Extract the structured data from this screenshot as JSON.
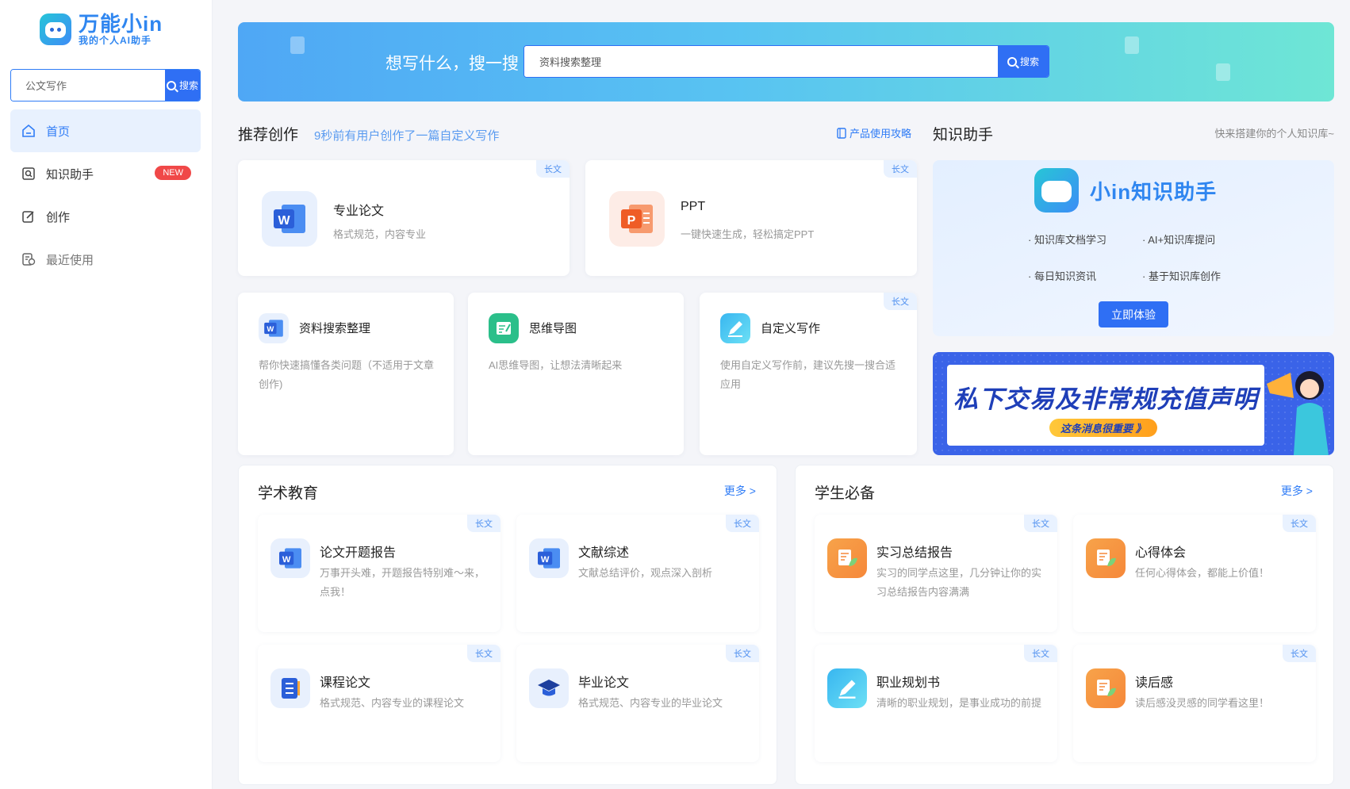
{
  "app": {
    "brand": "万能小in",
    "tagline": "我的个人AI助手"
  },
  "sidebar": {
    "search_value": "公文写作",
    "search_button": "搜索",
    "items": [
      {
        "label": "首页",
        "icon": "home-icon",
        "active": true
      },
      {
        "label": "知识助手",
        "icon": "knowledge-icon",
        "badge": "NEW"
      },
      {
        "label": "创作",
        "icon": "edit-icon"
      },
      {
        "label": "最近使用",
        "icon": "recent-icon"
      }
    ]
  },
  "banner": {
    "slogan": "想写什么，搜一搜",
    "search_value": "资料搜索整理",
    "search_button": "搜索"
  },
  "recommend": {
    "title": "推荐创作",
    "note": "9秒前有用户创作了一篇自定义写作",
    "guide_link": "产品使用攻略",
    "cards": [
      {
        "title": "专业论文",
        "desc": "格式规范，内容专业",
        "tag": "长文",
        "icon": "word-icon"
      },
      {
        "title": "PPT",
        "desc": "一键快速生成，轻松搞定PPT",
        "tag": "长文",
        "icon": "ppt-icon"
      },
      {
        "title": "资料搜索整理",
        "desc": "帮你快速搞懂各类问题（不适用于文章创作)",
        "icon": "word-icon"
      },
      {
        "title": "思维导图",
        "desc": "AI思维导图，让想法清晰起来",
        "icon": "mindmap-icon"
      },
      {
        "title": "自定义写作",
        "desc": "使用自定义写作前，建议先搜一搜合适应用",
        "tag": "长文",
        "icon": "pen-icon"
      }
    ]
  },
  "knowledge": {
    "title": "知识助手",
    "note": "快来搭建你的个人知识库~",
    "card_title": "小in知识助手",
    "features": [
      "· 知识库文档学习",
      "· AI+知识库提问",
      "· 每日知识资讯",
      "· 基于知识库创作"
    ],
    "button": "立即体验"
  },
  "notice": {
    "title": "私下交易及非常规充值声明",
    "sub": "这条消息很重要 》"
  },
  "academic": {
    "title": "学术教育",
    "more": "更多 >",
    "cards": [
      {
        "title": "论文开题报告",
        "desc": "万事开头难，开题报告特别难～来，点我！",
        "tag": "长文",
        "icon": "word-icon"
      },
      {
        "title": "文献综述",
        "desc": "文献总结评价，观点深入剖析",
        "tag": "长文",
        "icon": "word-icon"
      },
      {
        "title": "课程论文",
        "desc": "格式规范、内容专业的课程论文",
        "tag": "长文",
        "icon": "notebook-icon"
      },
      {
        "title": "毕业论文",
        "desc": "格式规范、内容专业的毕业论文",
        "tag": "长文",
        "icon": "graduation-cap-icon"
      }
    ]
  },
  "student": {
    "title": "学生必备",
    "more": "更多 >",
    "cards": [
      {
        "title": "实习总结报告",
        "desc": "实习的同学点这里，几分钟让你的实习总结报告内容满满",
        "tag": "长文",
        "icon": "report-icon"
      },
      {
        "title": "心得体会",
        "desc": "任何心得体会，都能上价值！",
        "tag": "长文",
        "icon": "report-icon"
      },
      {
        "title": "职业规划书",
        "desc": "清晰的职业规划，是事业成功的前提",
        "tag": "长文",
        "icon": "pen-icon"
      },
      {
        "title": "读后感",
        "desc": "读后感没灵感的同学看这里！",
        "tag": "长文",
        "icon": "report-icon"
      }
    ]
  },
  "colors": {
    "primary": "#2f6ff4",
    "accent_blue": "#2f86f0",
    "new_badge": "#f04848",
    "word": "#2b6de8",
    "ppt": "#f0622e",
    "mindmap": "#2bbf8a",
    "orange": "#f6883a"
  }
}
